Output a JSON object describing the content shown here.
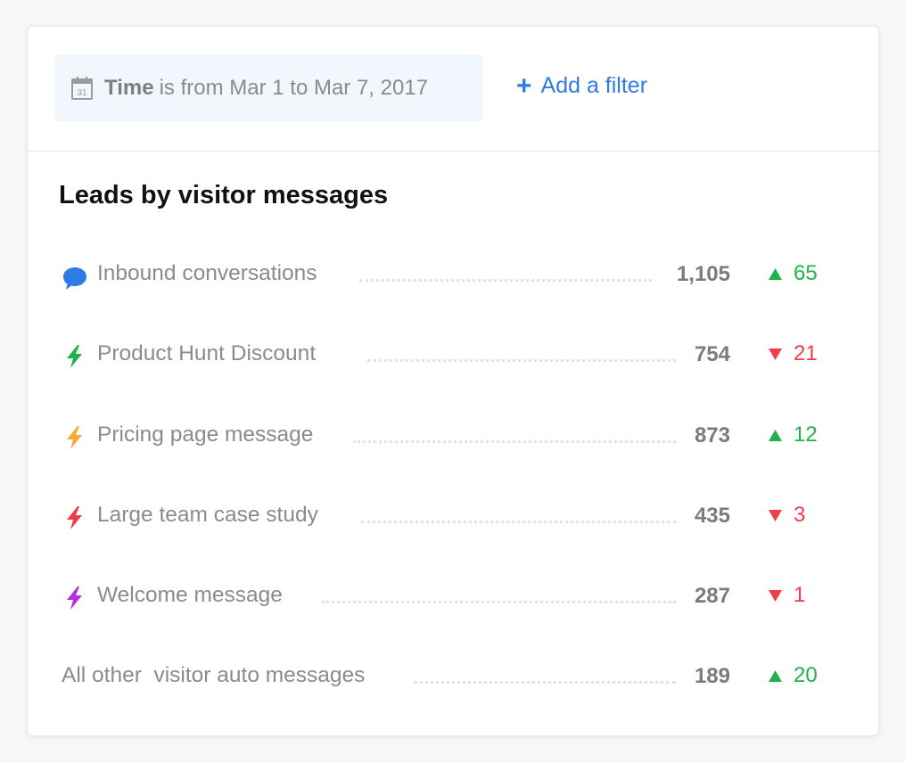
{
  "filter": {
    "field": "Time",
    "text": "is from Mar 1 to Mar 7, 2017",
    "calendar_day": "31",
    "add_label": "Add a filter"
  },
  "title": "Leads by visitor messages",
  "rows": [
    {
      "label": "Inbound conversations",
      "icon": "chat-bubble-icon",
      "icon_color": "#2f7be6",
      "value": "1,105",
      "direction": "up",
      "delta": "65"
    },
    {
      "label": "Product Hunt Discount",
      "icon": "bolt-icon",
      "icon_color": "#22b24c",
      "value": "754",
      "direction": "down",
      "delta": "21"
    },
    {
      "label": "Pricing page message",
      "icon": "bolt-icon",
      "icon_color": "#f6a935",
      "value": "873",
      "direction": "up",
      "delta": "12"
    },
    {
      "label": "Large team case study",
      "icon": "bolt-icon",
      "icon_color": "#f03c4b",
      "value": "435",
      "direction": "down",
      "delta": "3"
    },
    {
      "label": "Welcome message",
      "icon": "bolt-icon",
      "icon_color": "#b62ce0",
      "value": "287",
      "direction": "down",
      "delta": "1"
    },
    {
      "label": "All other  visitor auto messages",
      "icon": "",
      "icon_color": "",
      "value": "189",
      "direction": "up",
      "delta": "20"
    }
  ],
  "colors": {
    "accent": "#2f7be6",
    "up": "#22b24c",
    "down": "#f03c4b"
  }
}
